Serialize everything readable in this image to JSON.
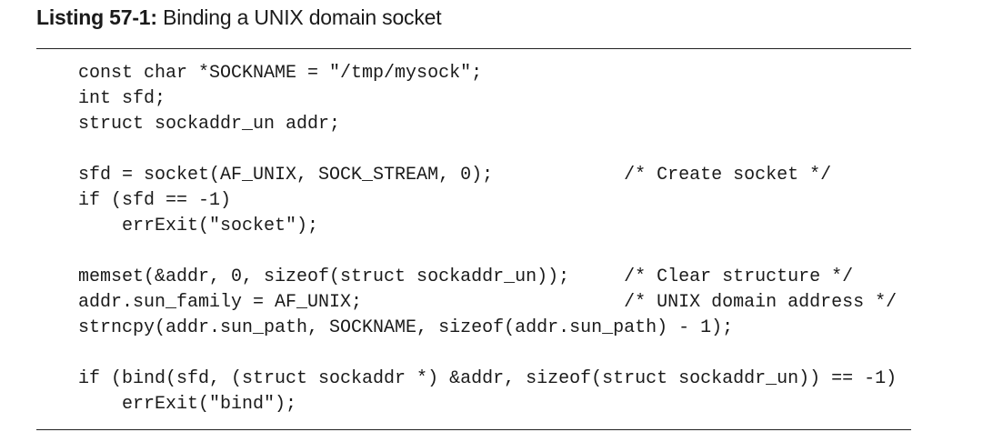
{
  "caption": {
    "label": "Listing 57-1:",
    "title": "Binding a UNIX domain socket"
  },
  "code": {
    "lines": [
      "const char *SOCKNAME = \"/tmp/mysock\";",
      "int sfd;",
      "struct sockaddr_un addr;",
      "",
      "sfd = socket(AF_UNIX, SOCK_STREAM, 0);            /* Create socket */",
      "if (sfd == -1)",
      "    errExit(\"socket\");",
      "",
      "memset(&addr, 0, sizeof(struct sockaddr_un));     /* Clear structure */",
      "addr.sun_family = AF_UNIX;                        /* UNIX domain address */",
      "strncpy(addr.sun_path, SOCKNAME, sizeof(addr.sun_path) - 1);",
      "",
      "if (bind(sfd, (struct sockaddr *) &addr, sizeof(struct sockaddr_un)) == -1)",
      "    errExit(\"bind\");"
    ]
  }
}
